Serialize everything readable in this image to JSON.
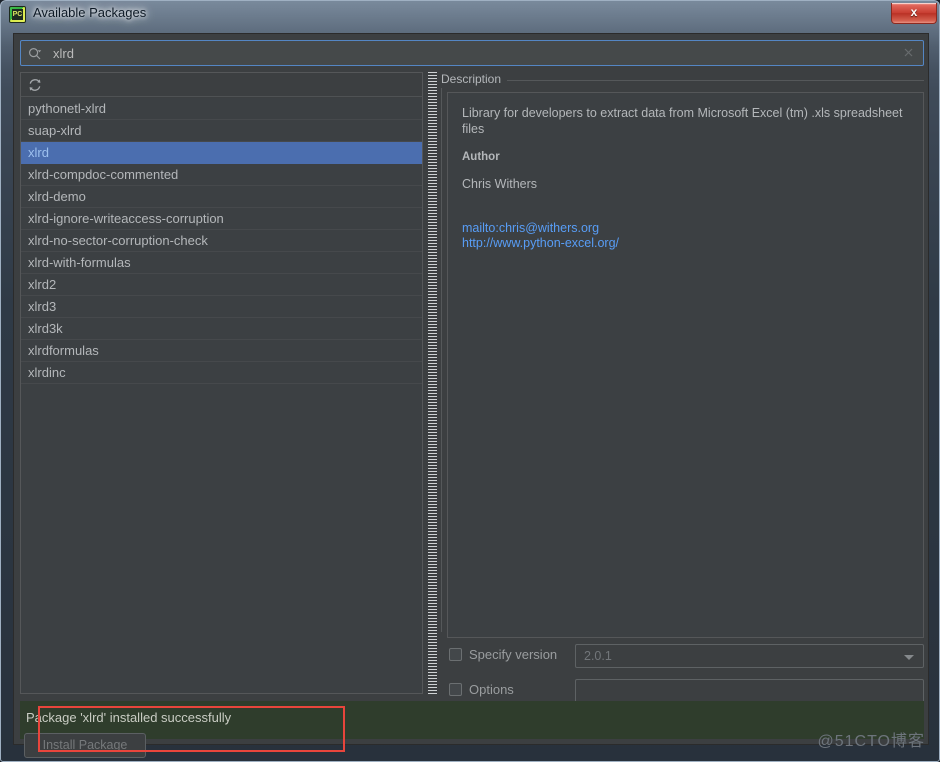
{
  "window": {
    "title": "Available Packages",
    "app_icon": "pycharm-icon",
    "app_icon_text": "PC",
    "close_label": "x"
  },
  "search": {
    "value": "xlrd",
    "placeholder": "",
    "icon": "search-icon",
    "clear_icon": "clear-icon"
  },
  "list": {
    "refresh_icon": "refresh-icon",
    "selected_index": 2,
    "items": [
      "pythonetl-xlrd",
      "suap-xlrd",
      "xlrd",
      "xlrd-compdoc-commented",
      "xlrd-demo",
      "xlrd-ignore-writeaccess-corruption",
      "xlrd-no-sector-corruption-check",
      "xlrd-with-formulas",
      "xlrd2",
      "xlrd3",
      "xlrd3k",
      "xlrdformulas",
      "xlrdinc"
    ]
  },
  "description": {
    "legend": "Description",
    "summary": "Library for developers to extract data from Microsoft Excel (tm) .xls spreadsheet files",
    "author_label": "Author",
    "author_name": "Chris Withers",
    "links": [
      "mailto:chris@withers.org",
      "http://www.python-excel.org/"
    ]
  },
  "options": {
    "specify_version_label": "Specify version",
    "specify_version_checked": false,
    "version_value": "2.0.1",
    "version_options": [
      "2.0.1"
    ],
    "options_label": "Options",
    "options_checked": false,
    "options_value": ""
  },
  "footer": {
    "status_message": "Package 'xlrd' installed successfully",
    "install_button_label": "Install Package",
    "install_button_enabled": false
  },
  "watermark": {
    "text": "@51CTO博客"
  },
  "colors": {
    "accent_selection": "#4b6eaf",
    "selection_text": "#9dc0ee",
    "link": "#589df6",
    "status_success_bg": "#2f3d2c",
    "annotation": "#e8453c",
    "dialog_bg": "#3c3f41",
    "panel_bg": "#3c4043"
  }
}
